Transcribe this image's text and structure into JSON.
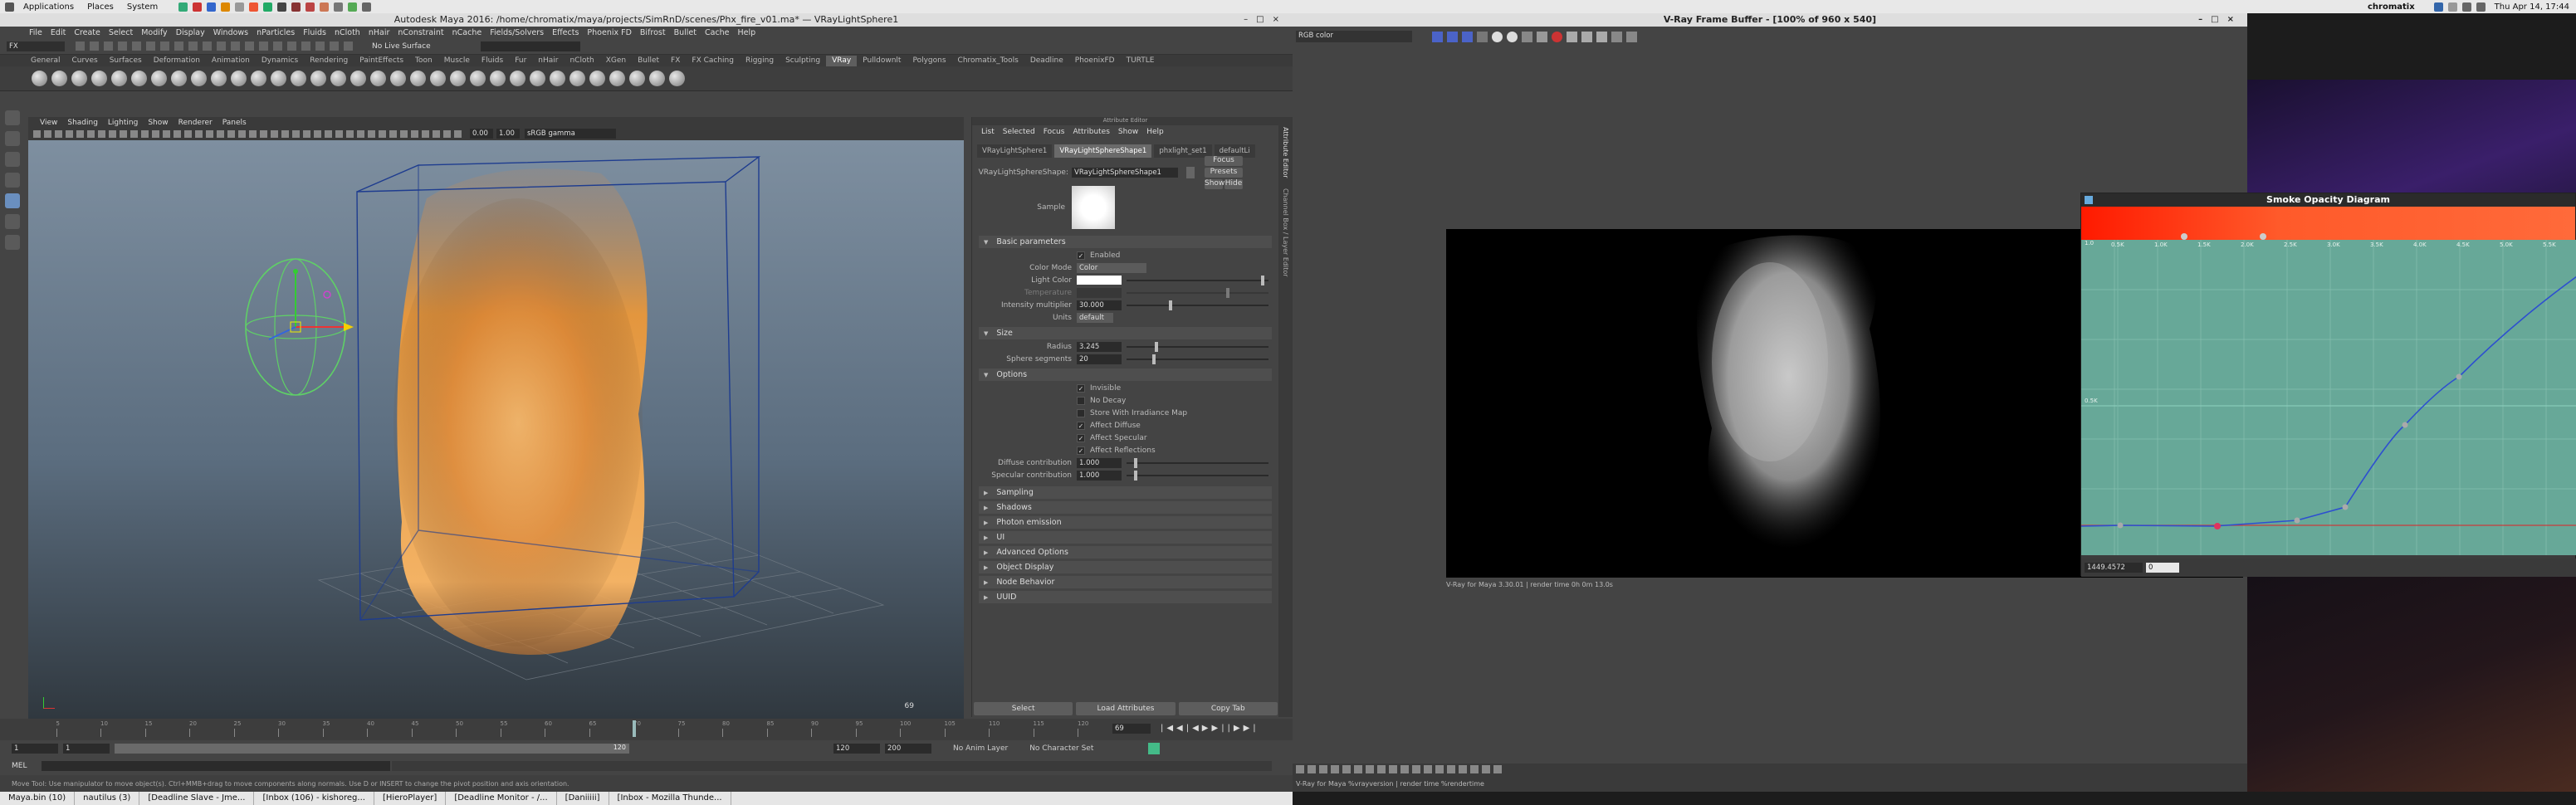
{
  "topbar": {
    "applications": "Applications",
    "places": "Places",
    "system": "System",
    "user": "chromatix",
    "datetime": "Thu Apr 14, 17:44"
  },
  "maya": {
    "title": "Autodesk Maya 2016: /home/chromatix/maya/projects/SimRnD/scenes/Phx_fire_v01.ma*  —  VRayLightSphere1",
    "menus": [
      "File",
      "Edit",
      "Create",
      "Select",
      "Modify",
      "Display",
      "Windows",
      "nParticles",
      "Fluids",
      "nCloth",
      "nHair",
      "nConstraint",
      "nCache",
      "Fields/Solvers",
      "Effects",
      "Phoenix FD",
      "Bifrost",
      "Bullet",
      "Cache",
      "Help"
    ],
    "mode": "FX",
    "live_surface": "No Live Surface",
    "shelf_tabs": [
      "General",
      "Curves",
      "Surfaces",
      "Deformation",
      "Animation",
      "Dynamics",
      "Rendering",
      "PaintEffects",
      "Toon",
      "Muscle",
      "Fluids",
      "Fur",
      "nHair",
      "nCloth",
      "XGen",
      "Bullet",
      "FX",
      "FX Caching",
      "Rigging",
      "Sculpting",
      "VRay",
      "Pulldownlt",
      "Polygons",
      "Chromatix_Tools",
      "Deadline",
      "PhoenixFD",
      "TURTLE"
    ],
    "active_shelf": "VRay",
    "viewport_menus": [
      "View",
      "Shading",
      "Lighting",
      "Show",
      "Renderer",
      "Panels"
    ],
    "gamma": "sRGB gamma",
    "vp_val1": "0.00",
    "vp_val2": "1.00",
    "frame_label": "69",
    "ae": {
      "menus": [
        "List",
        "Selected",
        "Focus",
        "Attributes",
        "Show",
        "Help"
      ],
      "header": "Attribute Editor",
      "tabs": [
        "VRayLightSphere1",
        "VRayLightSphereShape1",
        "phxlight_set1",
        "defaultLi"
      ],
      "shape_label": "VRayLightSphereShape:",
      "shape_value": "VRayLightSphereShape1",
      "focus": "Focus",
      "presets": "Presets",
      "show": "Show",
      "hide": "Hide",
      "sample": "Sample",
      "basic": "Basic parameters",
      "enabled": "Enabled",
      "color_mode_label": "Color Mode",
      "color_mode": "Color",
      "light_color": "Light Color",
      "temperature": "Temperature",
      "intensity_label": "Intensity multiplier",
      "intensity": "30.000",
      "units_label": "Units",
      "units": "default",
      "size": "Size",
      "radius_label": "Radius",
      "radius": "3.245",
      "segments_label": "Sphere segments",
      "segments": "20",
      "options": "Options",
      "opt_checks": [
        {
          "l": "Invisible",
          "c": true
        },
        {
          "l": "No Decay",
          "c": false
        },
        {
          "l": "Store With Irradiance Map",
          "c": false
        },
        {
          "l": "Affect Diffuse",
          "c": true
        },
        {
          "l": "Affect Specular",
          "c": true
        },
        {
          "l": "Affect Reflections",
          "c": true
        }
      ],
      "diffuse_label": "Diffuse contribution",
      "diffuse": "1.000",
      "specular_label": "Specular contribution",
      "specular": "1.000",
      "sections": [
        "Sampling",
        "Shadows",
        "Photon emission",
        "UI",
        "Advanced Options",
        "Object Display",
        "Node Behavior",
        "UUID"
      ],
      "btn_select": "Select",
      "btn_load": "Load Attributes",
      "btn_copy": "Copy Tab"
    },
    "side_tabs": [
      "Attribute Editor",
      "Channel Box / Layer Editor"
    ],
    "timeline": {
      "ticks": [
        "5",
        "10",
        "15",
        "20",
        "25",
        "30",
        "35",
        "40",
        "45",
        "50",
        "55",
        "60",
        "65",
        "70",
        "75",
        "80",
        "85",
        "90",
        "95",
        "100",
        "105",
        "110",
        "115",
        "120"
      ],
      "current": "69"
    },
    "range": {
      "start": "1",
      "start2": "1",
      "inner_end": "120",
      "end": "120",
      "end2": "200",
      "anim_layer": "No Anim Layer",
      "char_set": "No Character Set"
    },
    "mel": "MEL",
    "help_line": "Move Tool: Use manipulator to move object(s). Ctrl+MMB+drag to move components along normals. Use D or INSERT to change the pivot position and axis orientation."
  },
  "taskbar": [
    "Maya.bin (10)",
    "nautilus (3)",
    "[Deadline Slave - Jme...",
    "[Inbox (106) - kishoreg...",
    "[HieroPlayer]",
    "[Deadline Monitor - /...",
    "[Daniiiii]",
    "[Inbox - Mozilla Thunde..."
  ],
  "vray": {
    "title": "V-Ray Frame Buffer - [100% of 960 x 540]",
    "channel": "RGB color",
    "status": "V-Ray for Maya 3.30.01 | render time  0h  0m 13.0s",
    "footer": "V-Ray for Maya %vrayversion | render time %rendertime"
  },
  "smoke": {
    "title": "Smoke Opacity Diagram",
    "xticks": [
      "0.5K",
      "1.0K",
      "1.5K",
      "2.0K",
      "2.5K",
      "3.0K",
      "3.5K",
      "4.0K",
      "4.5K",
      "5.0K",
      "5.5K"
    ],
    "ytick": "0.5K",
    "y_top": "1.0",
    "coord_x": "1449.4572",
    "coord_y": "0"
  },
  "colors": {
    "fire": "#e08a3c",
    "curve": "#2d4fd0",
    "diagram_bg": "#67a898",
    "gradient_red": "#f0220a"
  }
}
